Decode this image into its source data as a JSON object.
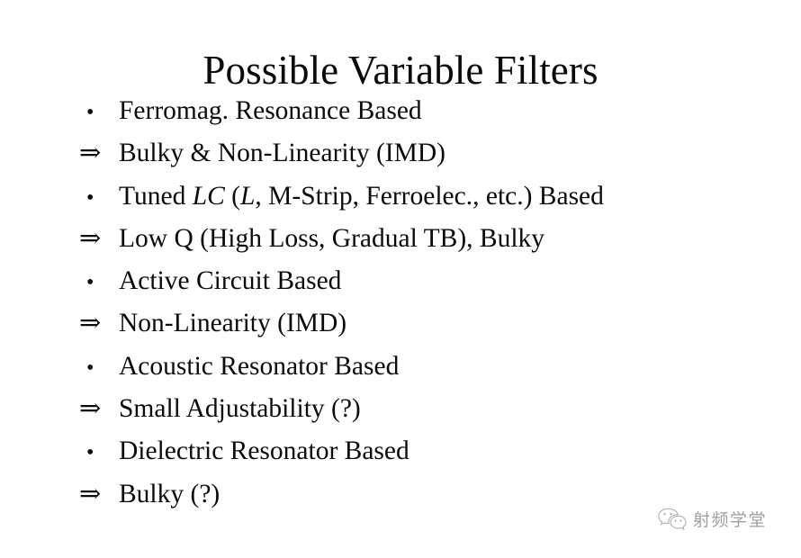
{
  "slide": {
    "title": "Possible Variable Filters",
    "background_color": "#ffffff",
    "text_color": "#0b0b0b",
    "bullet_glyph": "•",
    "arrow_glyph": "⇒",
    "lines": [
      {
        "marker": "•",
        "marker_type": "bullet",
        "text": "Ferromag. Resonance Based"
      },
      {
        "marker": "⇒",
        "marker_type": "arrow",
        "text": "Bulky & Non-Linearity (IMD)"
      },
      {
        "marker": "•",
        "marker_type": "bullet",
        "text": "Tuned LC (L, M-Strip, Ferroelec., etc.) Based",
        "text_pre": "Tuned ",
        "text_italic_1": "LC",
        "text_mid": " (",
        "text_italic_2": "L",
        "text_post": ", M-Strip, Ferroelec., etc.) Based"
      },
      {
        "marker": "⇒",
        "marker_type": "arrow",
        "text": "Low Q (High Loss, Gradual TB), Bulky"
      },
      {
        "marker": "•",
        "marker_type": "bullet",
        "text": "Active Circuit Based"
      },
      {
        "marker": "⇒",
        "marker_type": "arrow",
        "text": "Non-Linearity (IMD)"
      },
      {
        "marker": "•",
        "marker_type": "bullet",
        "text": "Acoustic Resonator Based"
      },
      {
        "marker": "⇒",
        "marker_type": "arrow",
        "text": "Small Adjustability (?)"
      },
      {
        "marker": "•",
        "marker_type": "bullet",
        "text": "Dielectric Resonator Based"
      },
      {
        "marker": "⇒",
        "marker_type": "arrow",
        "text": "Bulky (?)"
      }
    ]
  },
  "watermark": {
    "icon": "wechat-icon",
    "text": "射频学堂",
    "color": "#9c9c9c"
  }
}
